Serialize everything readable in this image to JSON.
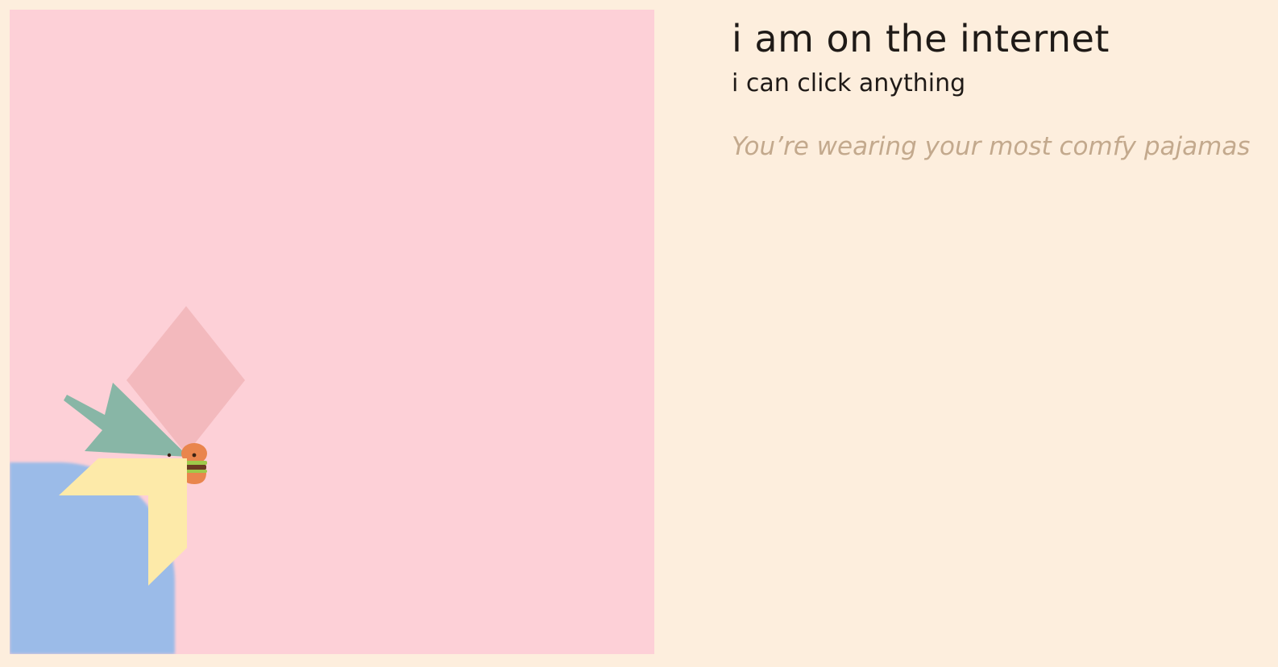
{
  "heading": {
    "title": "i am on the internet",
    "subtitle": "i can click anything"
  },
  "caption": "You’re wearing your most comfy pajamas",
  "canvas": {
    "background_color": "#fdd0d7",
    "shapes": [
      {
        "name": "blue-blob",
        "color": "#9bbbe8"
      },
      {
        "name": "pink-diamond",
        "color": "#f3b9bd"
      },
      {
        "name": "green-cursor-arrow-icon",
        "color": "#88b6a6"
      },
      {
        "name": "yellow-chevron",
        "color": "#fdeaa9"
      },
      {
        "name": "burger-icon",
        "color": "#e9854d"
      }
    ]
  },
  "page_background": "#fdeedd"
}
